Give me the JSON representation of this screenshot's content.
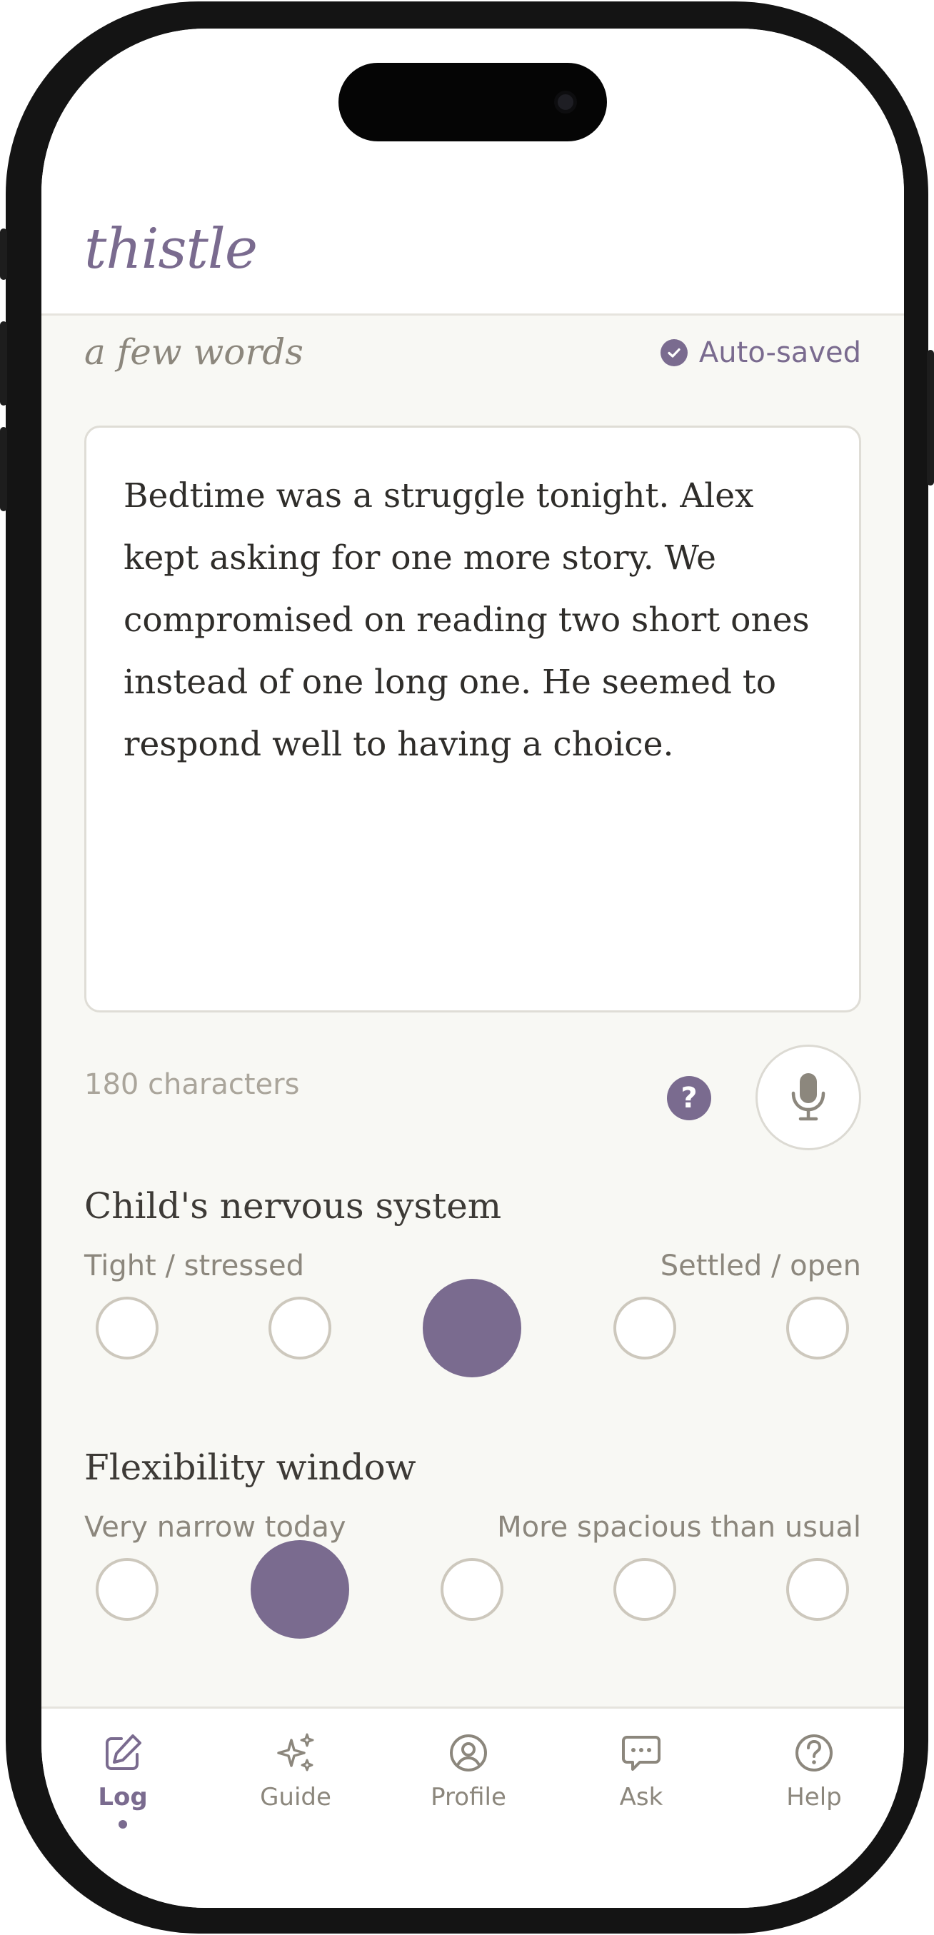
{
  "app": {
    "brand": "thistle"
  },
  "entry": {
    "section_title": "a few words",
    "autosave_status": "Auto-saved",
    "note_text": "Bedtime was a struggle tonight. Alex kept asking for one more story. We compromised on reading two short ones instead of one long one. He seemed to respond well to having a choice.",
    "character_count": "180 characters",
    "help_symbol": "?"
  },
  "scales": [
    {
      "title": "Child's nervous system",
      "low_label": "Tight / stressed",
      "high_label": "Settled / open",
      "options": 5,
      "selected": 3
    },
    {
      "title": "Flexibility window",
      "low_label": "Very narrow today",
      "high_label": "More spacious than usual",
      "options": 5,
      "selected": 2
    }
  ],
  "tabs": [
    {
      "label": "Log",
      "icon": "edit-icon",
      "active": true
    },
    {
      "label": "Guide",
      "icon": "sparkles-icon",
      "active": false
    },
    {
      "label": "Profile",
      "icon": "user-circle-icon",
      "active": false
    },
    {
      "label": "Ask",
      "icon": "chat-bubble-icon",
      "active": false
    },
    {
      "label": "Help",
      "icon": "help-circle-icon",
      "active": false
    }
  ],
  "colors": {
    "accent": "#7a6b8f",
    "background": "#f8f8f4",
    "muted_text": "#8c877d"
  }
}
